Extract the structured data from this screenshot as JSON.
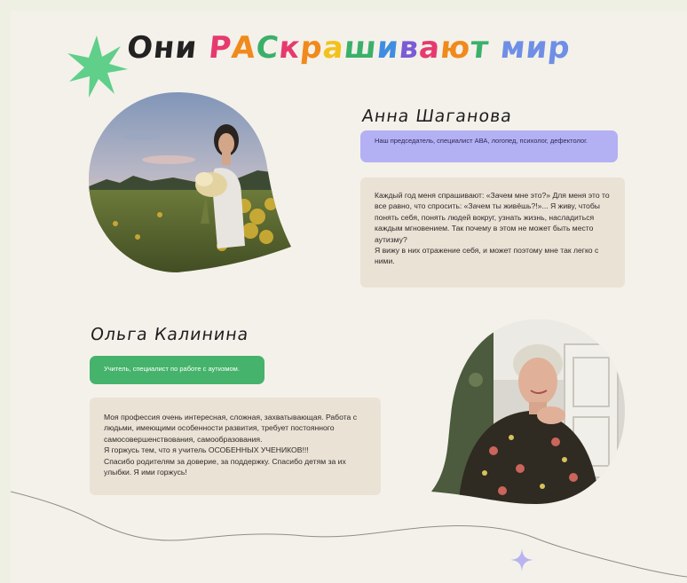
{
  "title": {
    "part1": "Они ",
    "letters": [
      {
        "ch": "Р",
        "color": "#e63a6e"
      },
      {
        "ch": "А",
        "color": "#f08a1c"
      },
      {
        "ch": "С",
        "color": "#3bb06b"
      },
      {
        "ch": "к",
        "color": "#e63a6e"
      },
      {
        "ch": "р",
        "color": "#f08a1c"
      },
      {
        "ch": "а",
        "color": "#f2c21c"
      },
      {
        "ch": "ш",
        "color": "#3bb06b"
      },
      {
        "ch": "и",
        "color": "#3f8de0"
      },
      {
        "ch": "в",
        "color": "#7b5bd6"
      },
      {
        "ch": "а",
        "color": "#e63a6e"
      },
      {
        "ch": "ю",
        "color": "#f08a1c"
      },
      {
        "ch": "т",
        "color": "#3bb06b"
      }
    ],
    "part3": " мир",
    "part3_color": "#6f8fe6"
  },
  "person1": {
    "name": "Анна Шаганова",
    "role": "Наш председатель, специалист АВА, логопед, психолог, дефектолог.",
    "quote": [
      "Каждый год меня спрашивают: «Зачем мне это?» Для меня это то все равно, что спросить: «Зачем ты живёшь?!»... Я живу, чтобы понять себя, понять людей вокруг, узнать жизнь, насладиться каждым мгновением. Так почему в этом не может быть место аутизму?",
      "Я вижу в них отражение себя, и может поэтому мне так легко с ними."
    ]
  },
  "person2": {
    "name": "Ольга Калинина",
    "role": "Учитель, специалист по работе с аутизмом.",
    "quote": [
      "Моя профессия очень интересная, сложная, захватывающая. Работа с людьми, имеющими особенности развития, требует постоянного самосовершенствования, самообразования.",
      "Я горжусь тем, что я учитель ОСОБЕННЫХ УЧЕНИКОВ!!!",
      "Спасибо родителям за доверие, за поддержку. Спасибо детям за их улыбки. Я ими горжусь!"
    ]
  },
  "colors": {
    "badge1_bg": "#b4b0f4",
    "badge2_bg": "#45b36b",
    "star_green": "#5fcf8a",
    "star_purple": "#b9b4ef"
  }
}
